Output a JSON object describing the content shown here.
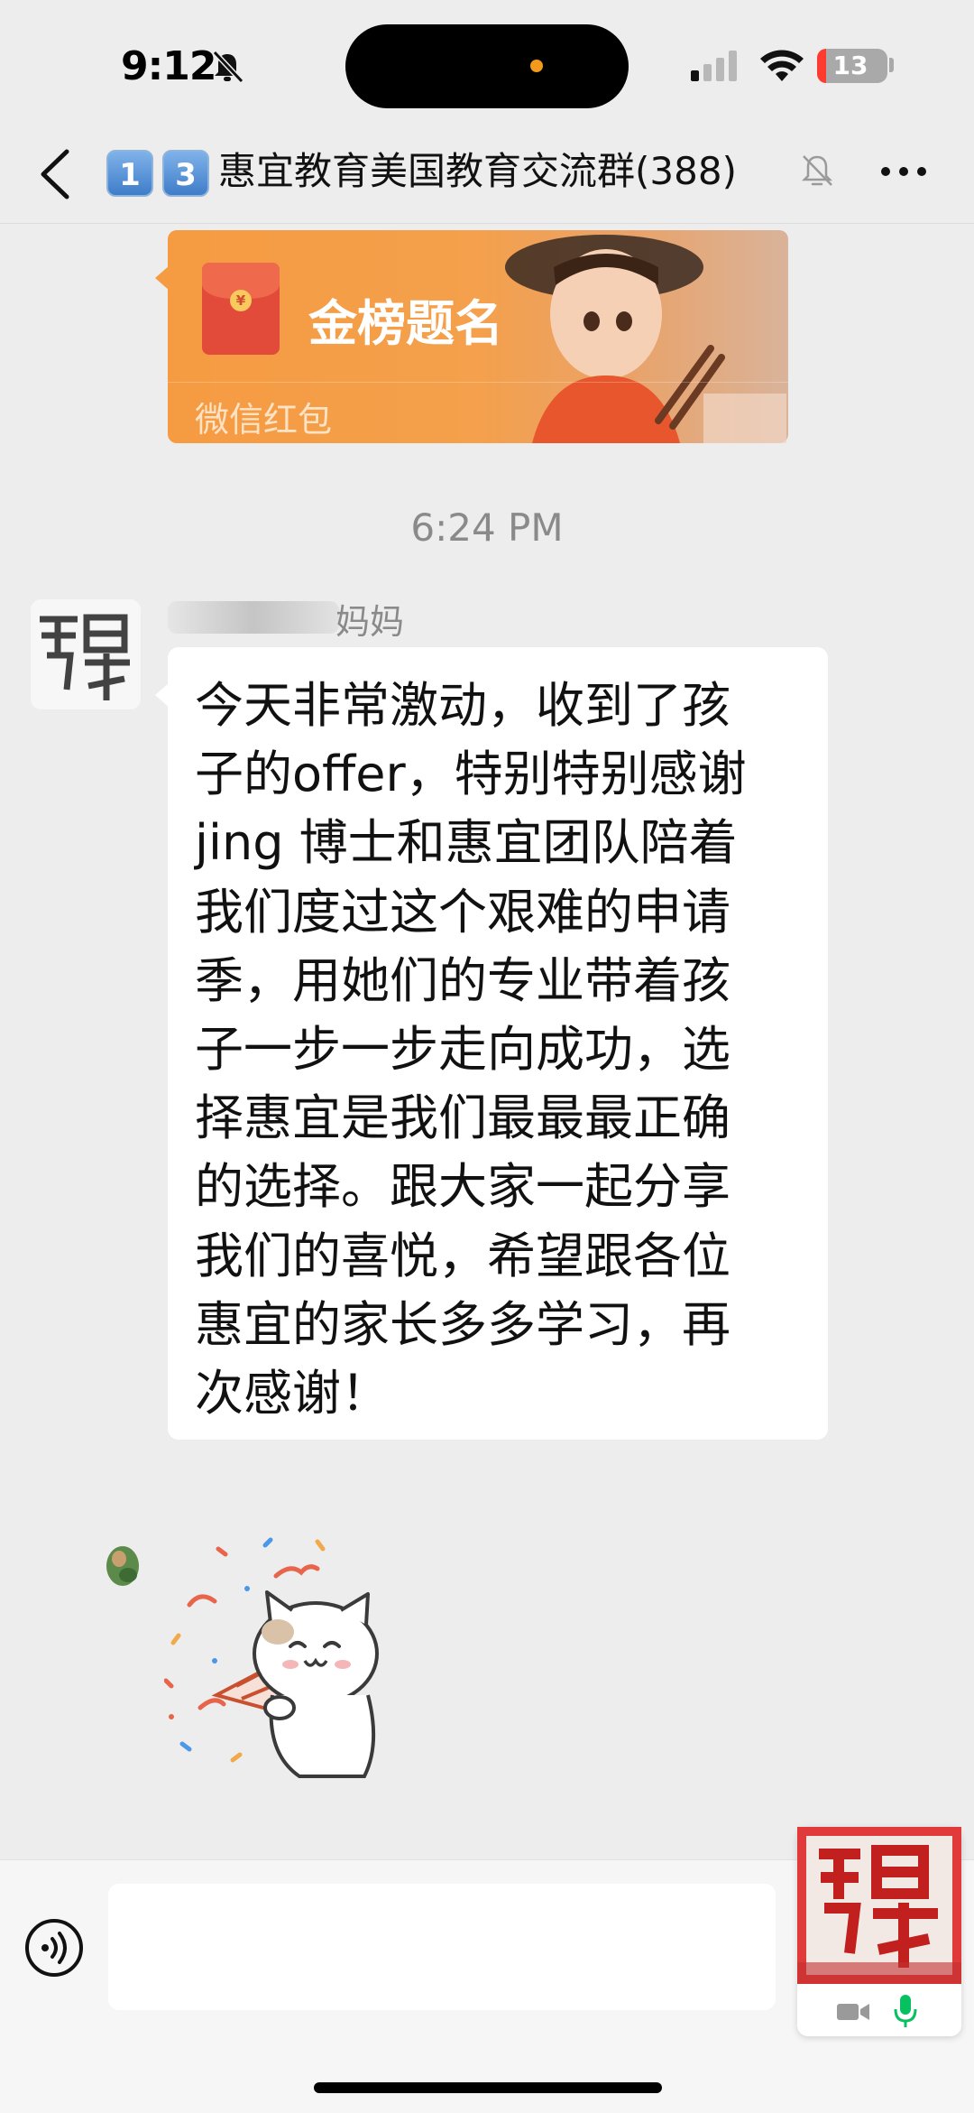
{
  "status_bar": {
    "time": "9:12",
    "battery": "13"
  },
  "header": {
    "badge_1": "1",
    "badge_2": "3",
    "title": "惠宜教育美国教育交流群",
    "member_count": "(388)"
  },
  "messages": {
    "red_packet": {
      "title": "金榜题名",
      "label": "微信红包"
    },
    "timestamp": "6:24 PM",
    "text_message": {
      "sender_name": "妈妈",
      "lines": [
        "今天非常激动，收到了孩",
        "子的offer，特别特别感谢",
        "jing 博士和惠宜团队陪着",
        "我们度过这个艰难的申请",
        "季，用她们的专业带着孩",
        "子一步一步走向成功，选",
        "择惠宜是我们最最最正确",
        "的选择。跟大家一起分享",
        "我们的喜悦，希望跟各位",
        "惠宜的家长多多学习，再",
        "次感谢！"
      ]
    }
  },
  "input_bar": {
    "message_value": ""
  },
  "colors": {
    "background": "#ededed",
    "red_packet": "#f59b42",
    "bubble": "#ffffff",
    "accent_green": "#07c160"
  },
  "icons": [
    "chevron-left-icon",
    "bell-off-icon",
    "more-icon",
    "voice-icon",
    "video-icon",
    "mic-icon",
    "signal-icon",
    "wifi-icon"
  ]
}
